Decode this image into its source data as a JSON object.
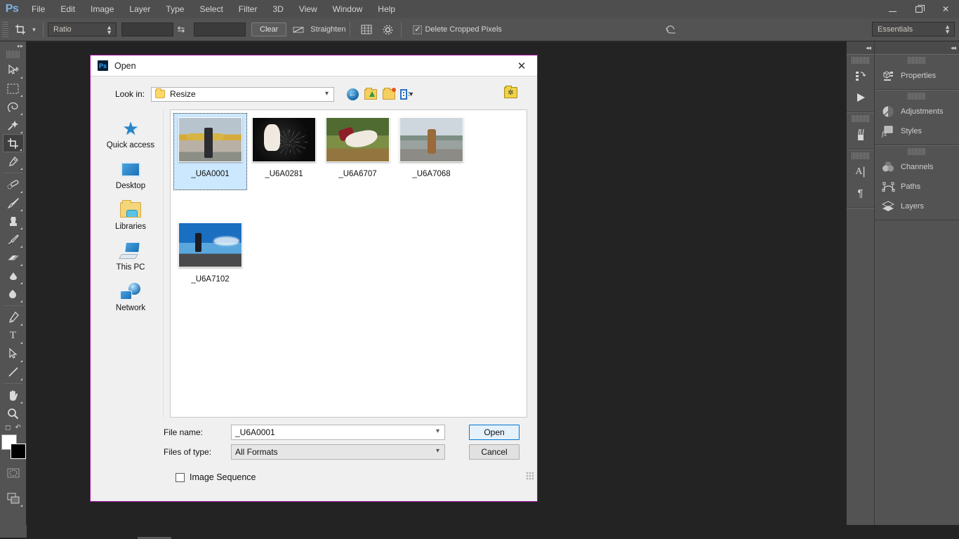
{
  "app": {
    "logo": "Ps",
    "menus": [
      "File",
      "Edit",
      "Image",
      "Layer",
      "Type",
      "Select",
      "Filter",
      "3D",
      "View",
      "Window",
      "Help"
    ],
    "window_controls": {
      "minimize": "minimize-button",
      "maximize": "maximize-button",
      "close": "close-button"
    }
  },
  "options_bar": {
    "tool_icon": "crop-tool-icon",
    "ratio_select": "Ratio",
    "width_value": "",
    "height_value": "",
    "swap_icon": "swap-width-height-icon",
    "clear_label": "Clear",
    "straighten_icon": "straighten-icon",
    "straighten_label": "Straighten",
    "overlay_icon": "crop-overlay-icon",
    "settings_icon": "gear-icon",
    "delete_cropped_label": "Delete Cropped Pixels",
    "delete_cropped_checked": "✓",
    "reset_icon": "reset-icon",
    "workspace": "Essentials"
  },
  "toolbar": {
    "collapse_icon": "expand-panels-icon",
    "tools": [
      {
        "name": "move-tool",
        "glyph": "➤"
      },
      {
        "name": "rectangular-marquee-tool",
        "glyph": "⬚"
      },
      {
        "name": "lasso-tool",
        "glyph": "✡"
      },
      {
        "name": "magic-wand-tool",
        "glyph": "✦"
      },
      {
        "name": "crop-tool",
        "glyph": "⌗",
        "active": true
      },
      {
        "name": "eyedropper-tool",
        "glyph": "✐"
      },
      {
        "name": "spot-healing-brush-tool",
        "glyph": "⊕"
      },
      {
        "name": "brush-tool",
        "glyph": "✎"
      },
      {
        "name": "clone-stamp-tool",
        "glyph": "⚑"
      },
      {
        "name": "history-brush-tool",
        "glyph": "✒"
      },
      {
        "name": "eraser-tool",
        "glyph": "▱"
      },
      {
        "name": "gradient-tool",
        "glyph": "◩"
      },
      {
        "name": "blur-tool",
        "glyph": "◖"
      },
      {
        "name": "dodge-tool",
        "glyph": "●"
      },
      {
        "name": "pen-tool",
        "glyph": "✑"
      },
      {
        "name": "type-tool",
        "glyph": "T"
      },
      {
        "name": "path-selection-tool",
        "glyph": "↖"
      },
      {
        "name": "line-shape-tool",
        "glyph": "╱"
      },
      {
        "name": "hand-tool",
        "glyph": "✋"
      },
      {
        "name": "zoom-tool",
        "glyph": "⌕"
      }
    ],
    "default_colors_icon": "default-colors-icon",
    "swap_colors_icon": "swap-colors-icon",
    "foreground_color": "#ffffff",
    "background_color": "#000000",
    "quick_mask_icon": "quick-mask-icon",
    "screen_mode_icon": "screen-mode-icon"
  },
  "dock_narrow": {
    "collapse_icon": "collapse-panels-icon",
    "items": [
      {
        "name": "history-panel-icon",
        "glyph": "↺"
      },
      {
        "name": "actions-panel-icon",
        "glyph": "▶"
      },
      {
        "name": "brush-panel-icon",
        "glyph": "❃"
      },
      {
        "name": "character-panel-icon",
        "glyph": "A"
      },
      {
        "name": "paragraph-panel-icon",
        "glyph": "¶"
      }
    ]
  },
  "dock_wide": {
    "collapse_icon": "collapse-panels-icon",
    "groups": [
      {
        "items": [
          {
            "label": "Properties",
            "icon": "properties-icon",
            "glyph": "▤"
          }
        ]
      },
      {
        "items": [
          {
            "label": "Adjustments",
            "icon": "adjustments-icon",
            "glyph": "◐"
          },
          {
            "label": "Styles",
            "icon": "styles-icon",
            "glyph": "fx"
          }
        ]
      },
      {
        "items": [
          {
            "label": "Channels",
            "icon": "channels-icon",
            "glyph": "◑"
          },
          {
            "label": "Paths",
            "icon": "paths-icon",
            "glyph": "⤵"
          },
          {
            "label": "Layers",
            "icon": "layers-icon",
            "glyph": "⬛"
          }
        ]
      }
    ]
  },
  "dialog": {
    "icon": "photoshop-icon",
    "icon_text": "Ps",
    "title": "Open",
    "close_icon": "close-icon",
    "look_in_label": "Look in:",
    "look_in_value": "Resize",
    "nav_icons": [
      {
        "name": "back-button",
        "glyph": "←"
      },
      {
        "name": "up-one-level-button",
        "glyph": "↑"
      },
      {
        "name": "create-new-folder-button",
        "glyph": "+"
      },
      {
        "name": "change-view-button",
        "glyph": "☷"
      }
    ],
    "right_icon": "favorites-icon",
    "places": [
      {
        "label": "Quick access",
        "icon": "quick-access-icon"
      },
      {
        "label": "Desktop",
        "icon": "desktop-icon"
      },
      {
        "label": "Libraries",
        "icon": "libraries-icon"
      },
      {
        "label": "This PC",
        "icon": "this-pc-icon"
      },
      {
        "label": "Network",
        "icon": "network-icon"
      }
    ],
    "files": [
      {
        "name": "_U6A0001",
        "selected": true,
        "art": "a1"
      },
      {
        "name": "_U6A0281",
        "selected": false,
        "art": "a2"
      },
      {
        "name": "_U6A6707",
        "selected": false,
        "art": "a3"
      },
      {
        "name": "_U6A7068",
        "selected": false,
        "art": "a4"
      },
      {
        "name": "_U6A7102",
        "selected": false,
        "art": "a5"
      }
    ],
    "file_name_label": "File name:",
    "file_name_value": "_U6A0001",
    "files_of_type_label": "Files of type:",
    "files_of_type_value": "All Formats",
    "open_button": "Open",
    "cancel_button": "Cancel",
    "image_sequence_label": "Image Sequence",
    "image_sequence_checked": false,
    "border_color": "#a413a4"
  }
}
